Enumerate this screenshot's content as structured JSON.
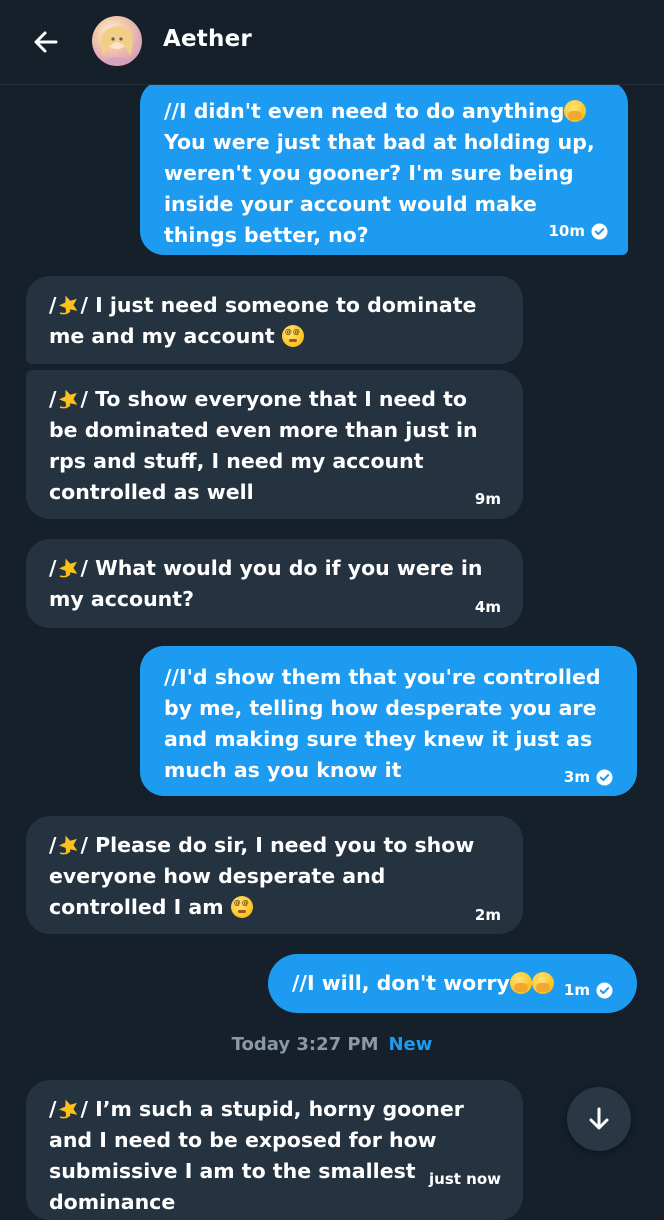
{
  "header": {
    "contact_name": "Aether"
  },
  "colors": {
    "background": "#15202b",
    "sent_bubble": "#1d9bf0",
    "received_bubble": "#253341",
    "muted_text": "#8b98a5",
    "new_tag": "#1d9bf0"
  },
  "icons": {
    "back": "arrow-left-icon",
    "read_receipt": "check-circle-icon",
    "scroll_down": "arrow-down-icon",
    "emoji_star": "dizzy-star-emoji",
    "emoji_dizzy": "dizzy-face-emoji",
    "emoji_hand": "hand-over-mouth-emoji"
  },
  "messages": [
    {
      "direction": "sent",
      "text": "//I didn't even need to do anything",
      "text_after": " You were just that bad at holding up, weren't you gooner? I'm sure being inside your account would make things better, no?",
      "time": "10m",
      "read": true
    },
    {
      "direction": "received",
      "prefix": "/",
      "prefix_after": "/ ",
      "text": "I just need someone to dominate me and my account",
      "time": ""
    },
    {
      "direction": "received",
      "prefix": "/",
      "prefix_after": "/ ",
      "text": "To show everyone that I need to be dominated even more than just in rps and stuff, I need my account controlled as well",
      "time": "9m"
    },
    {
      "direction": "received",
      "prefix": "/",
      "prefix_after": "/ ",
      "text": "What would you do if you were in my account?",
      "time": "4m"
    },
    {
      "direction": "sent",
      "text": "//I'd show them that you're controlled by me, telling how desperate you are and making sure they knew it just as much as you know it",
      "time": "3m",
      "read": true
    },
    {
      "direction": "received",
      "prefix": "/",
      "prefix_after": "/ ",
      "text": "Please do sir, I need you to show everyone how desperate and controlled I am",
      "time": "2m"
    },
    {
      "direction": "sent",
      "text": "//I will, don't worry",
      "time": "1m",
      "read": true
    },
    {
      "direction": "received",
      "prefix": "/",
      "prefix_after": "/ ",
      "text": "I’m such a stupid, horny gooner and I need to be exposed for how submissive I am to the smallest dominance",
      "time": "just now"
    }
  ],
  "date_separator": {
    "label": "Today 3:27 PM",
    "new_label": "New"
  }
}
